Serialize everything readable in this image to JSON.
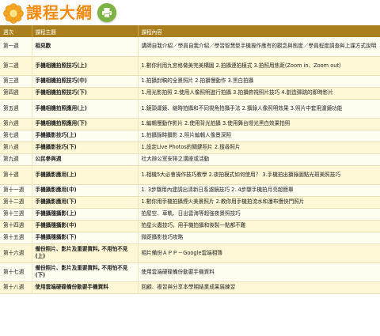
{
  "header": {
    "title": "課程大綱",
    "accent_color": "#f08a10",
    "print_icon": "printer-icon"
  },
  "table": {
    "columns": [
      "週次",
      "課程主題",
      "課程內容"
    ],
    "rows": [
      {
        "week": "第一週",
        "topic": "相見歡",
        "content": "講師自我介紹／學員自我介紹／學習智慧型手機操作應有的觀念與態度／學員程度調查與上課方式說明"
      },
      {
        "week": "第二週",
        "topic": "手機相機拍照技巧(上)",
        "content": "1.數你利用九宮格做美完美構圖 2.拍攝連拍模式 3.拍照用焦距(Zoom in、Zoom out)"
      },
      {
        "week": "第三週",
        "topic": "手機相機拍照技巧(中)",
        "content": "1.拍攝封稿的全景照片 2.拍攝慢動作 3.黑白拍攝"
      },
      {
        "week": "第四週",
        "topic": "手機相機拍照技巧(下)",
        "content": "1.用光影拍照 2.使用人像照明進行拍攝 3.拍攝俯視照片技巧 4.創造彈跳的即時影片"
      },
      {
        "week": "第五週",
        "topic": "手機相機拍照應用(上)",
        "content": "1.鏡頭運鏡、縮時拍攝和不同視角拍攝手法 2.攝錄人像照明效果 3.照片中套用濾鏡功能"
      },
      {
        "week": "第六週",
        "topic": "手機相機拍照應用(下)",
        "content": "1.編輯慢動作影片 2.使用背光拍攝 3.使用舞台燈光黑白效果拍照"
      },
      {
        "week": "第七週",
        "topic": "手機攝影技巧(上)",
        "content": "1.拍攝錄時攝影 2.照片編輯人像景深照"
      },
      {
        "week": "第八週",
        "topic": "手機攝影技巧(下)",
        "content": "1.設定Live Photos的關鍵照片 2.搜尋照片"
      },
      {
        "week": "第九週",
        "topic": "公民參與週",
        "content": "社大辦公室安排之講座或活動"
      },
      {
        "week": "第十週",
        "topic": "手機攝影應用(上)",
        "content": "1.相機5大必會操作技巧教學 2.夜拍模式如何使用？ 3.手機拍出攝錄圖點光斑美照技巧"
      },
      {
        "week": "第十一週",
        "topic": "手機攝影應用(中)",
        "content": "1. 3步驟用內建調出清新日系濾鏡技巧 2. 4步驟手機拍月亮超簡單"
      },
      {
        "week": "第十二週",
        "topic": "手機攝影應用(下)",
        "content": "1.數你用手機拍攝煙火美景照片 2.教你用手機拍流水和瀑布慢快門照片"
      },
      {
        "week": "第十三週",
        "topic": "手機攝隨攝影(上)",
        "content": "拍屋空、車軌、日出雲海等超強夜景照技巧"
      },
      {
        "week": "第十四週",
        "topic": "手機攝隨攝影(中)",
        "content": "拍星火蟲技巧，用手機拍攝和後製一點都不難"
      },
      {
        "week": "第十五週",
        "topic": "手機攝隨攝影(下)",
        "content": "微距攝影技巧攻略"
      },
      {
        "week": "第十六週",
        "topic": "備份照片、影片及重要資料, 不用怕不見(上)",
        "content": "相片備份ＡＰＰ－Google雲端相簿"
      },
      {
        "week": "第十七週",
        "topic": "備份照片、影片及重要資料, 不用怕不見(下)",
        "content": "使用雲端硬碟備份動要手機資料"
      },
      {
        "week": "第十八週",
        "topic": "使用雲端硬碟備份動要手機資料",
        "content": "回顧、複習與分享本學期結業成果展練習"
      }
    ]
  }
}
